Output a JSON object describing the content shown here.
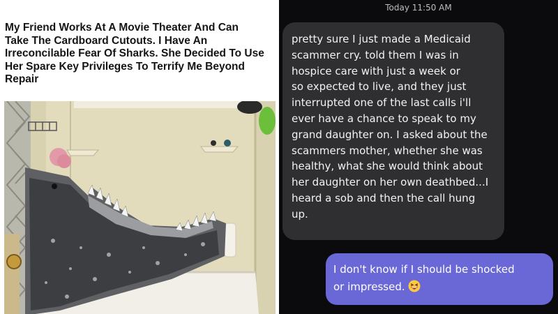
{
  "meme": {
    "title_lines": [
      "My Friend Works At A Movie Theater And Can",
      "Take The Cardboard Cutouts. I Have An",
      "Irreconcilable Fear Of Sharks. She Decided To Use",
      "Her Spare Key Privileges To Terrify Me Beyond",
      "Repair"
    ]
  },
  "chat": {
    "timestamp": "Today 11:50 AM",
    "incoming_lines": [
      "pretty sure I just made a Medicaid",
      "scammer cry. told them I was in",
      "hospice care with just a week or",
      "so expected to live, and they just",
      "interrupted one of the last calls i'll",
      "ever have a chance to speak to my",
      "grand daughter on. I asked about the",
      "scammers mother, whether she was",
      "healthy, what she would think about",
      "her daughter on her own deathbed...I",
      "heard a sob and then the call hung",
      "up."
    ],
    "outgoing_lines": [
      "I don't know if I should be shocked",
      "or impressed."
    ],
    "outgoing_emoji": "grinning-squinting-face-icon"
  },
  "colors": {
    "incoming_bubble": "#2f2f31",
    "outgoing_bubble": "#6a67d6",
    "background": "#0b0b0d"
  }
}
